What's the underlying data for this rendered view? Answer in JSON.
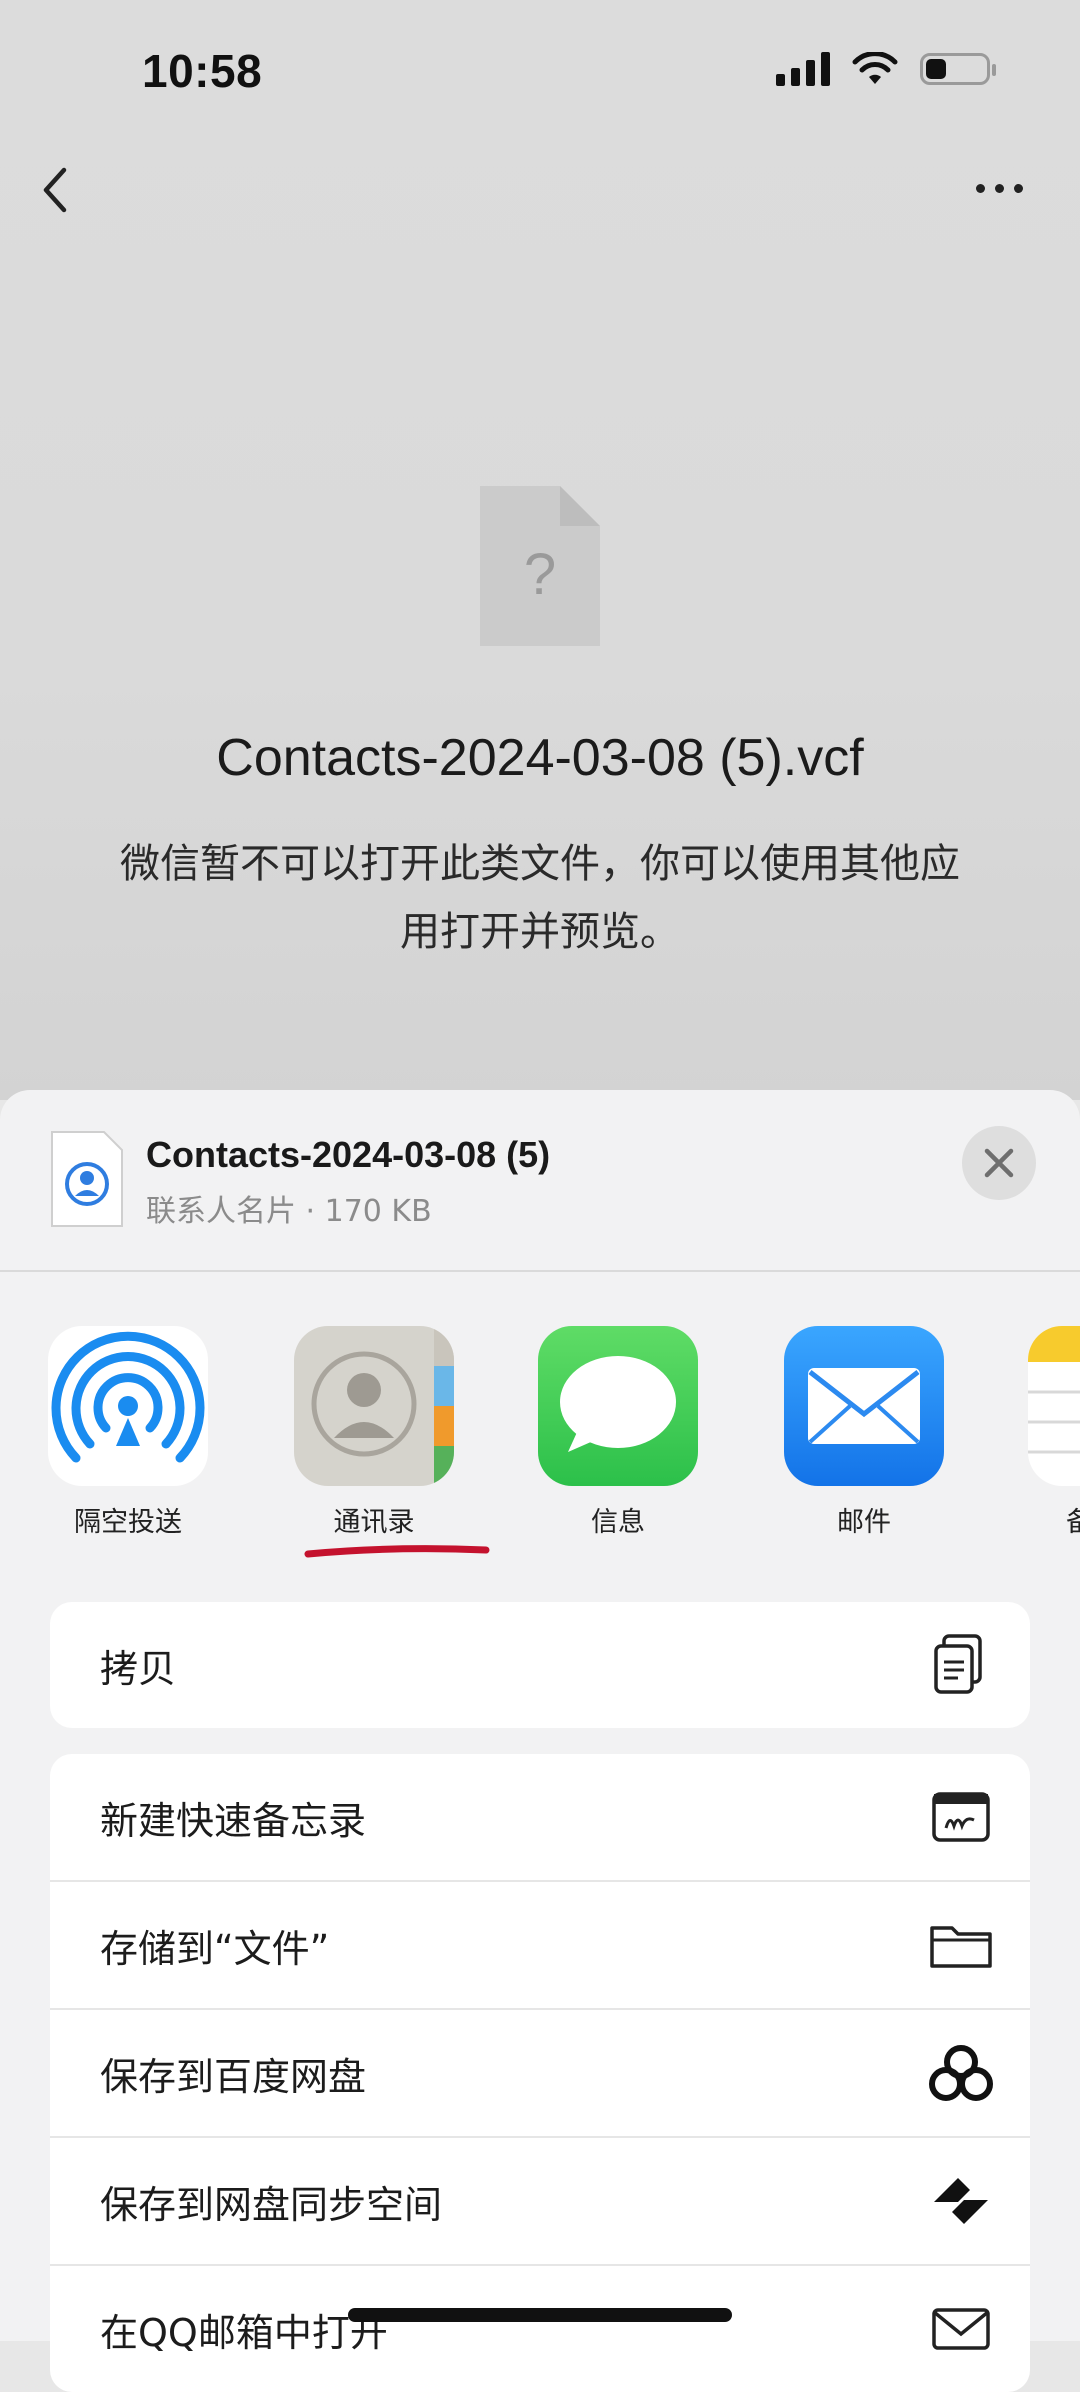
{
  "status": {
    "time": "10:58"
  },
  "page": {
    "file_name": "Contacts-2024-03-08 (5).vcf",
    "message": "微信暂不可以打开此类文件，你可以使用其他应用打开并预览。",
    "placeholder_glyph": "?"
  },
  "sheet": {
    "title": "Contacts-2024-03-08 (5)",
    "subtitle": "联系人名片 · 170 KB",
    "apps": [
      {
        "label": "隔空投送",
        "icon": "airdrop-icon"
      },
      {
        "label": "通讯录",
        "icon": "contacts-icon"
      },
      {
        "label": "信息",
        "icon": "messages-icon"
      },
      {
        "label": "邮件",
        "icon": "mail-icon"
      },
      {
        "label": "备",
        "icon": "notes-icon"
      }
    ],
    "actions_group1": [
      {
        "label": "拷贝",
        "icon": "copy-icon"
      }
    ],
    "actions_group2": [
      {
        "label": "新建快速备忘录",
        "icon": "quick-note-icon"
      },
      {
        "label": "存储到“文件”",
        "icon": "folder-icon"
      },
      {
        "label": "保存到百度网盘",
        "icon": "baidu-netdisk-icon"
      },
      {
        "label": "保存到网盘同步空间",
        "icon": "sync-space-icon"
      },
      {
        "label": "在QQ邮箱中打开",
        "icon": "envelope-icon"
      }
    ]
  },
  "colors": {
    "accent_underline": "#c4122d",
    "messages_green": "#34c759",
    "mail_blue": "#1e8cf5",
    "airdrop_blue": "#1a8cf0"
  }
}
